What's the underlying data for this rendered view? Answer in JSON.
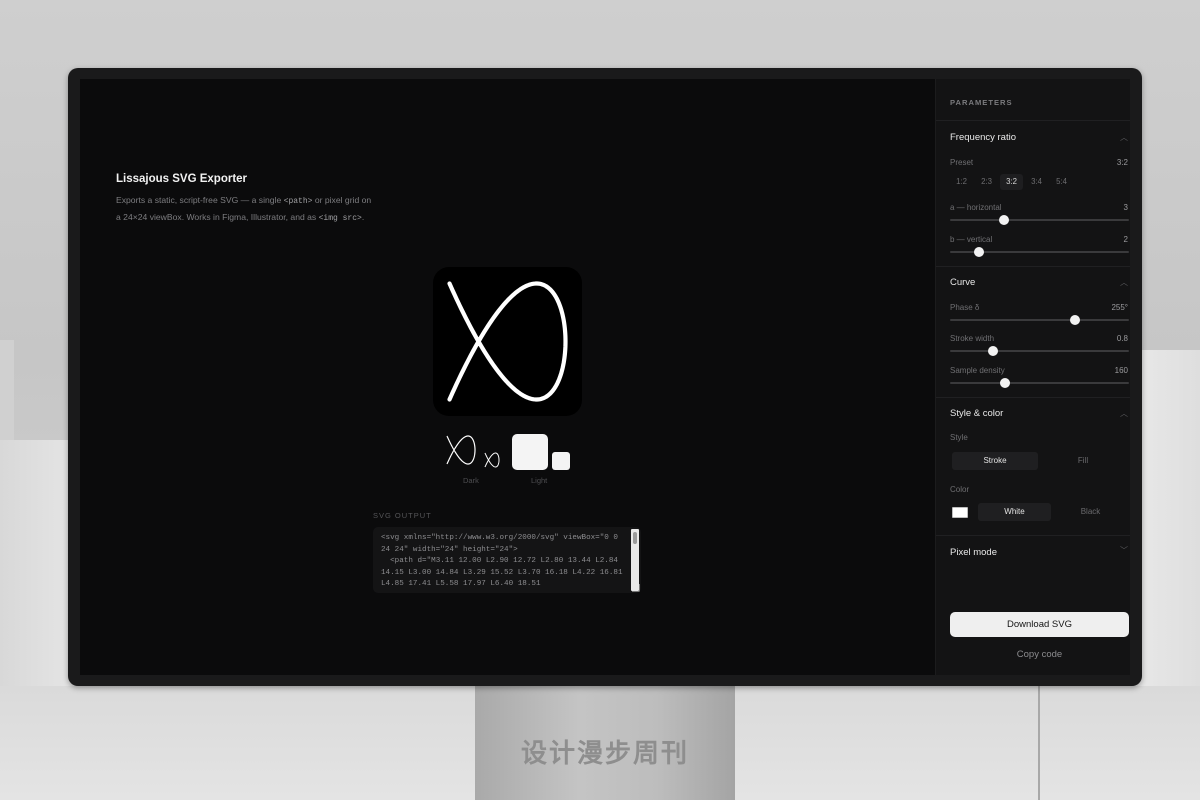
{
  "scene": {
    "stand_brand": "设计漫步周刊"
  },
  "app": {
    "title": "Lissajous SVG Exporter",
    "desc_part1": "Exports a static, script-free SVG — a single ",
    "desc_code1": "<path>",
    "desc_part2": " or pixel grid on a 24×24 viewBox. Works in Figma, Illustrator, and as ",
    "desc_code2": "<img src>",
    "desc_part3": "."
  },
  "preview": {
    "thumb_dark_label": "Dark",
    "thumb_light_label": "Light"
  },
  "output": {
    "label": "SVG OUTPUT",
    "code": "<svg xmlns=\"http://www.w3.org/2000/svg\" viewBox=\"0 0 24 24\" width=\"24\" height=\"24\">\n  <path d=\"M3.11 12.00 L2.90 12.72 L2.80 13.44 L2.84 14.15 L3.00 14.84 L3.29 15.52 L3.70 16.18 L4.22 16.81 L4.85 17.41 L5.58 17.97 L6.40 18.51"
  },
  "panel": {
    "header": "PARAMETERS",
    "frequency": {
      "title": "Frequency ratio",
      "preset_label": "Preset",
      "preset_value": "3:2",
      "presets": [
        "1:2",
        "2:3",
        "3:2",
        "3:4",
        "5:4"
      ],
      "active_preset": 2,
      "a_label": "a — horizontal",
      "a_value": "3",
      "a_fraction": 0.3,
      "b_label": "b — vertical",
      "b_value": "2",
      "b_fraction": 0.16
    },
    "curve": {
      "title": "Curve",
      "phase_label": "Phase δ",
      "phase_value": "255°",
      "phase_fraction": 0.7,
      "stroke_label": "Stroke width",
      "stroke_value": "0.8",
      "stroke_fraction": 0.24,
      "density_label": "Sample density",
      "density_value": "160",
      "density_fraction": 0.31
    },
    "style": {
      "title": "Style & color",
      "style_label": "Style",
      "style_options": [
        "Stroke",
        "Fill"
      ],
      "active_style": 0,
      "color_label": "Color",
      "color_options": [
        "White",
        "Black"
      ],
      "active_color": 0,
      "swatch_color": "#ffffff"
    },
    "pixel": {
      "title": "Pixel mode"
    },
    "download_label": "Download SVG",
    "copy_label": "Copy code"
  }
}
